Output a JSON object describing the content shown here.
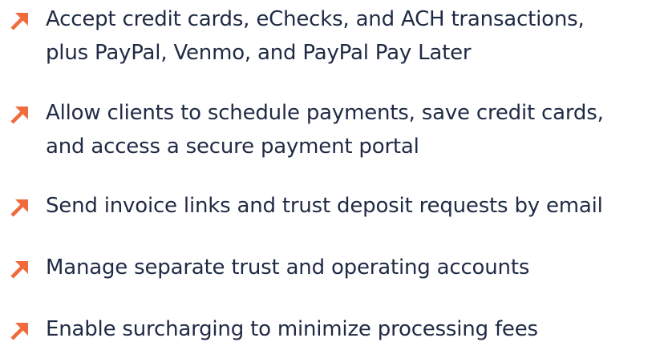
{
  "features": {
    "accent_color": "#f06a3b",
    "text_color": "#1f2a44",
    "icon": "arrow-up-right-icon",
    "items": [
      {
        "line1": "Accept credit cards, eChecks, and ACH transactions,",
        "line2": "plus PayPal, Venmo, and PayPal Pay Later"
      },
      {
        "line1": "Allow clients to schedule payments, save credit cards,",
        "line2": "and access a secure payment portal"
      },
      {
        "line1": "Send invoice links and trust deposit requests by email",
        "line2": ""
      },
      {
        "line1": "Manage separate trust and operating accounts",
        "line2": ""
      },
      {
        "line1": "Enable surcharging to minimize processing fees",
        "line2": ""
      }
    ]
  }
}
